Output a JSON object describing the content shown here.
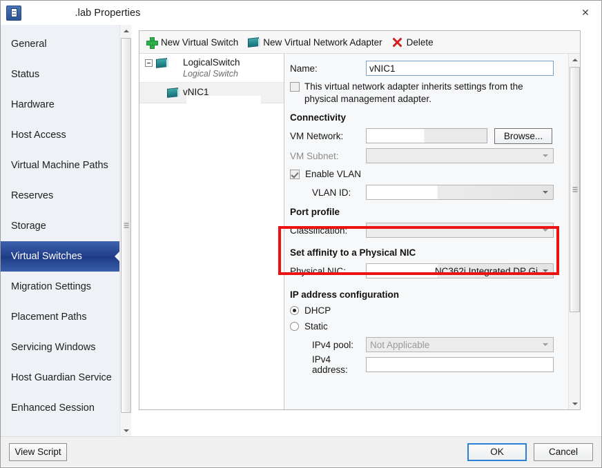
{
  "window": {
    "title": ".lab Properties",
    "icon": "properties-icon",
    "close_label": "✕"
  },
  "sidebar": {
    "items": [
      {
        "label": "General",
        "selected": false
      },
      {
        "label": "Status",
        "selected": false
      },
      {
        "label": "Hardware",
        "selected": false
      },
      {
        "label": "Host Access",
        "selected": false
      },
      {
        "label": "Virtual Machine Paths",
        "selected": false
      },
      {
        "label": "Reserves",
        "selected": false
      },
      {
        "label": "Storage",
        "selected": false
      },
      {
        "label": "Virtual Switches",
        "selected": true
      },
      {
        "label": "Migration Settings",
        "selected": false
      },
      {
        "label": "Placement Paths",
        "selected": false
      },
      {
        "label": "Servicing Windows",
        "selected": false
      },
      {
        "label": "Host Guardian Service",
        "selected": false
      },
      {
        "label": "Enhanced Session",
        "selected": false
      }
    ]
  },
  "toolbar": {
    "new_switch": "New Virtual Switch",
    "new_adapter": "New Virtual Network Adapter",
    "delete": "Delete"
  },
  "tree": {
    "switch_name": "LogicalSwitch",
    "switch_type": "Logical Switch",
    "adapter_name": "vNIC1"
  },
  "form": {
    "name_label": "Name:",
    "name_value": "vNIC1",
    "inherit_text": "This virtual network adapter inherits settings from the physical management adapter.",
    "inherit_checked": false,
    "connectivity_header": "Connectivity",
    "vm_network_label": "VM Network:",
    "vm_network_value": "",
    "browse_label": "Browse...",
    "vm_subnet_label": "VM Subnet:",
    "vm_subnet_value": "",
    "enable_vlan_label": "Enable VLAN",
    "enable_vlan_checked": true,
    "vlan_id_label": "VLAN ID:",
    "vlan_id_value": "",
    "port_profile_header": "Port profile",
    "classification_label": "Classification:",
    "classification_value": "",
    "affinity_header": "Set affinity to a Physical NIC",
    "physical_nic_label": "Physical NIC:",
    "physical_nic_value": "NC362i Integrated DP Gi",
    "ip_config_header": "IP address configuration",
    "dhcp_label": "DHCP",
    "dhcp_selected": true,
    "static_label": "Static",
    "static_selected": false,
    "ipv4_pool_label": "IPv4 pool:",
    "ipv4_pool_value": "Not Applicable",
    "ipv4_address_label": "IPv4 address:",
    "ipv4_address_value": ""
  },
  "footer": {
    "view_script": "View Script",
    "ok": "OK",
    "cancel": "Cancel"
  },
  "colors": {
    "accent": "#23408c",
    "highlight": "#ee1111",
    "focus": "#2b7fd4"
  }
}
